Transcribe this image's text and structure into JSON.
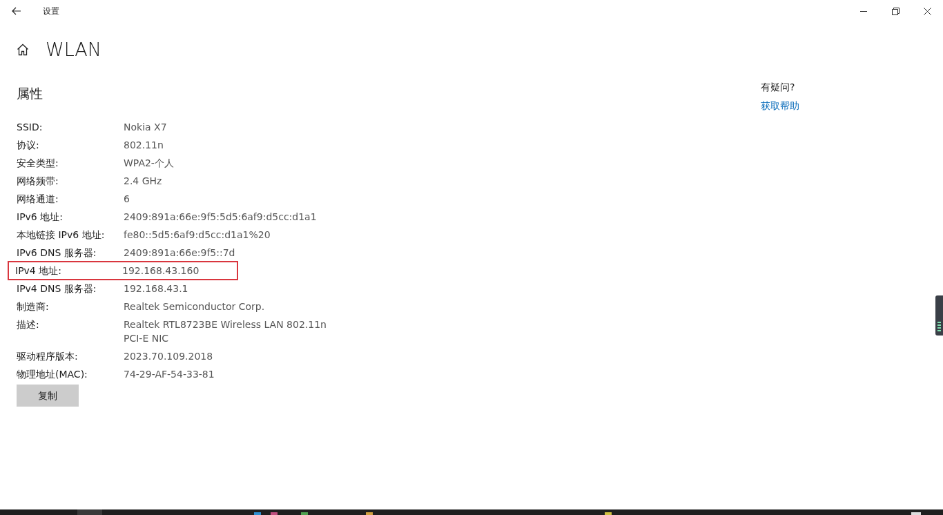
{
  "window": {
    "title": "设置"
  },
  "page": {
    "title": "WLAN"
  },
  "section": {
    "title": "属性"
  },
  "properties": [
    {
      "label": "SSID:",
      "value": [
        "Nokia X7"
      ],
      "highlighted": false
    },
    {
      "label": "协议:",
      "value": [
        "802.11n"
      ],
      "highlighted": false
    },
    {
      "label": "安全类型:",
      "value": [
        "WPA2-个人"
      ],
      "highlighted": false
    },
    {
      "label": "网络频带:",
      "value": [
        "2.4 GHz"
      ],
      "highlighted": false
    },
    {
      "label": "网络通道:",
      "value": [
        "6"
      ],
      "highlighted": false
    },
    {
      "label": "IPv6 地址:",
      "value": [
        "2409:891a:66e:9f5:5d5:6af9:d5cc:d1a1"
      ],
      "highlighted": false
    },
    {
      "label": "本地链接 IPv6 地址:",
      "value": [
        "fe80::5d5:6af9:d5cc:d1a1%20"
      ],
      "highlighted": false
    },
    {
      "label": "IPv6 DNS 服务器:",
      "value": [
        "2409:891a:66e:9f5::7d"
      ],
      "highlighted": false
    },
    {
      "label": "IPv4 地址:",
      "value": [
        "192.168.43.160"
      ],
      "highlighted": true
    },
    {
      "label": "IPv4 DNS 服务器:",
      "value": [
        "192.168.43.1"
      ],
      "highlighted": false
    },
    {
      "label": "制造商:",
      "value": [
        "Realtek Semiconductor Corp."
      ],
      "highlighted": false
    },
    {
      "label": "描述:",
      "value": [
        "Realtek RTL8723BE Wireless LAN 802.11n",
        "PCI-E NIC"
      ],
      "highlighted": false
    },
    {
      "label": "驱动程序版本:",
      "value": [
        "2023.70.109.2018"
      ],
      "highlighted": false
    },
    {
      "label": "物理地址(MAC):",
      "value": [
        "74-29-AF-54-33-81"
      ],
      "highlighted": false
    }
  ],
  "copy_button": "复制",
  "help": {
    "question": "有疑问?",
    "link": "获取帮助"
  }
}
